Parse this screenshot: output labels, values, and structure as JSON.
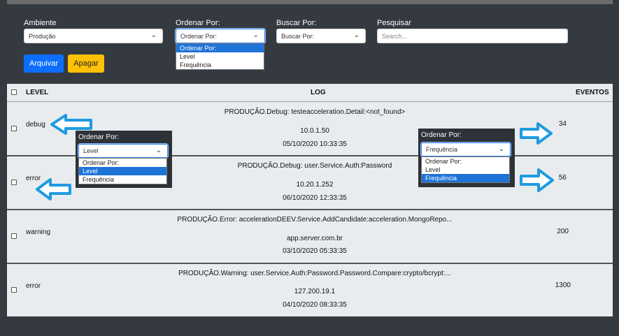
{
  "filters": {
    "ambiente_label": "Ambiente",
    "ambiente_value": "Produção",
    "ordenar_label": "Ordenar Por:",
    "ordenar_value": "Ordenar Por:",
    "ordenar_options": [
      "Ordenar Por:",
      "Level",
      "Frequência"
    ],
    "buscar_label": "Buscar Por:",
    "buscar_value": "Buscar Por:",
    "pesquisar_label": "Pesquisar",
    "pesquisar_placeholder": "Search..."
  },
  "buttons": {
    "arquivar": "Arquivar",
    "apagar": "Apagar"
  },
  "table": {
    "headers": {
      "level": "LEVEL",
      "log": "LOG",
      "eventos": "EVENTOS"
    },
    "rows": [
      {
        "level": "debug",
        "message": "PRODUÇÃO.Debug: testeacceleration.Detail:<not_found>",
        "host": "10.0.1.50",
        "date": "05/10/2020 10:33:35",
        "events": "34"
      },
      {
        "level": "error",
        "message": "PRODUÇÃO.Debug: user.Service.Auth:Password",
        "host": "10.20.1.252",
        "date": "06/10/2020 12:33:35",
        "events": "56"
      },
      {
        "level": "warning",
        "message": "PRODUÇÃO.Error: accelerationDEEV.Service.AddCandidate:acceleration.MongoRepo...",
        "host": "app.server.com.br",
        "date": "03/10/2020 05:33:35",
        "events": "200"
      },
      {
        "level": "error",
        "message": "PRODUÇÃO.Warning: user.Service.Auth:Password.Password.Compare:crypto/bcrypt:...",
        "host": "127.200.19.1",
        "date": "04/10/2020 08:33:35",
        "events": "1300"
      }
    ]
  },
  "popup_left": {
    "title": "Ordenar Por:",
    "value": "Level",
    "options": [
      "Ordenar Por:",
      "Level",
      "Frequência"
    ],
    "selected_index": 1
  },
  "popup_right": {
    "title": "Ordenar Por:",
    "value": "Frequência",
    "options": [
      "Ordenar Por:",
      "Level",
      "Frequência"
    ],
    "selected_index": 2
  },
  "colors": {
    "background": "#343a40",
    "primary": "#0d6efd",
    "warning": "#ffc107",
    "selected_option": "#1e73d8",
    "annotation_arrow": "#1e9be0"
  },
  "icons": {
    "chevron": "chevron-down-icon",
    "arrow_left": "arrow-left-icon",
    "arrow_right": "arrow-right-icon"
  }
}
